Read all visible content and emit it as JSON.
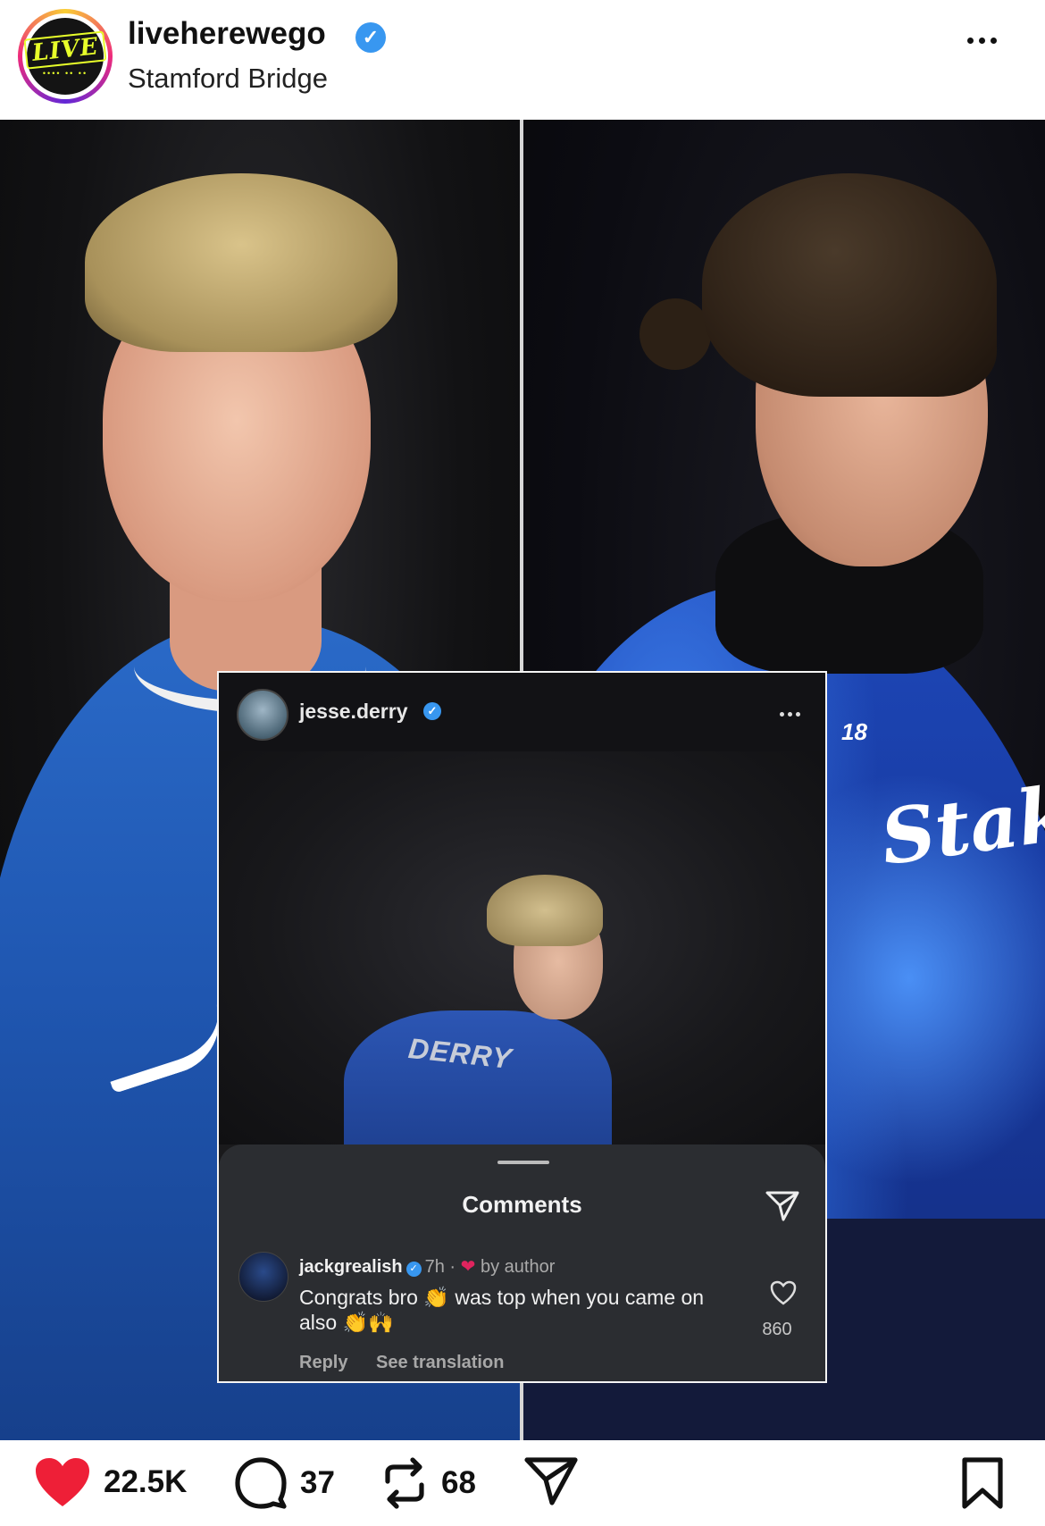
{
  "header": {
    "username": "liveherewego",
    "location": "Stamford Bridge",
    "avatar_text": "LIVE",
    "avatar_subtext": "•••• •• ••"
  },
  "media": {
    "left_player_sponsor": "",
    "right_player_number": "18",
    "right_player_sponsor": "Stak"
  },
  "embedded_post": {
    "username": "jesse.derry",
    "shirt_name": "DERRY",
    "comments_title": "Comments",
    "comment": {
      "username": "jackgrealish",
      "time": "7h",
      "author_flag": "by author",
      "text": "Congrats bro 👏 was top when you came on also 👏🙌",
      "reply_label": "Reply",
      "translate_label": "See translation",
      "likes": "860"
    }
  },
  "actions": {
    "likes": "22.5K",
    "comments": "37",
    "reposts": "68"
  },
  "colors": {
    "like_red": "#e0245e",
    "verified_blue": "#3897f0"
  }
}
